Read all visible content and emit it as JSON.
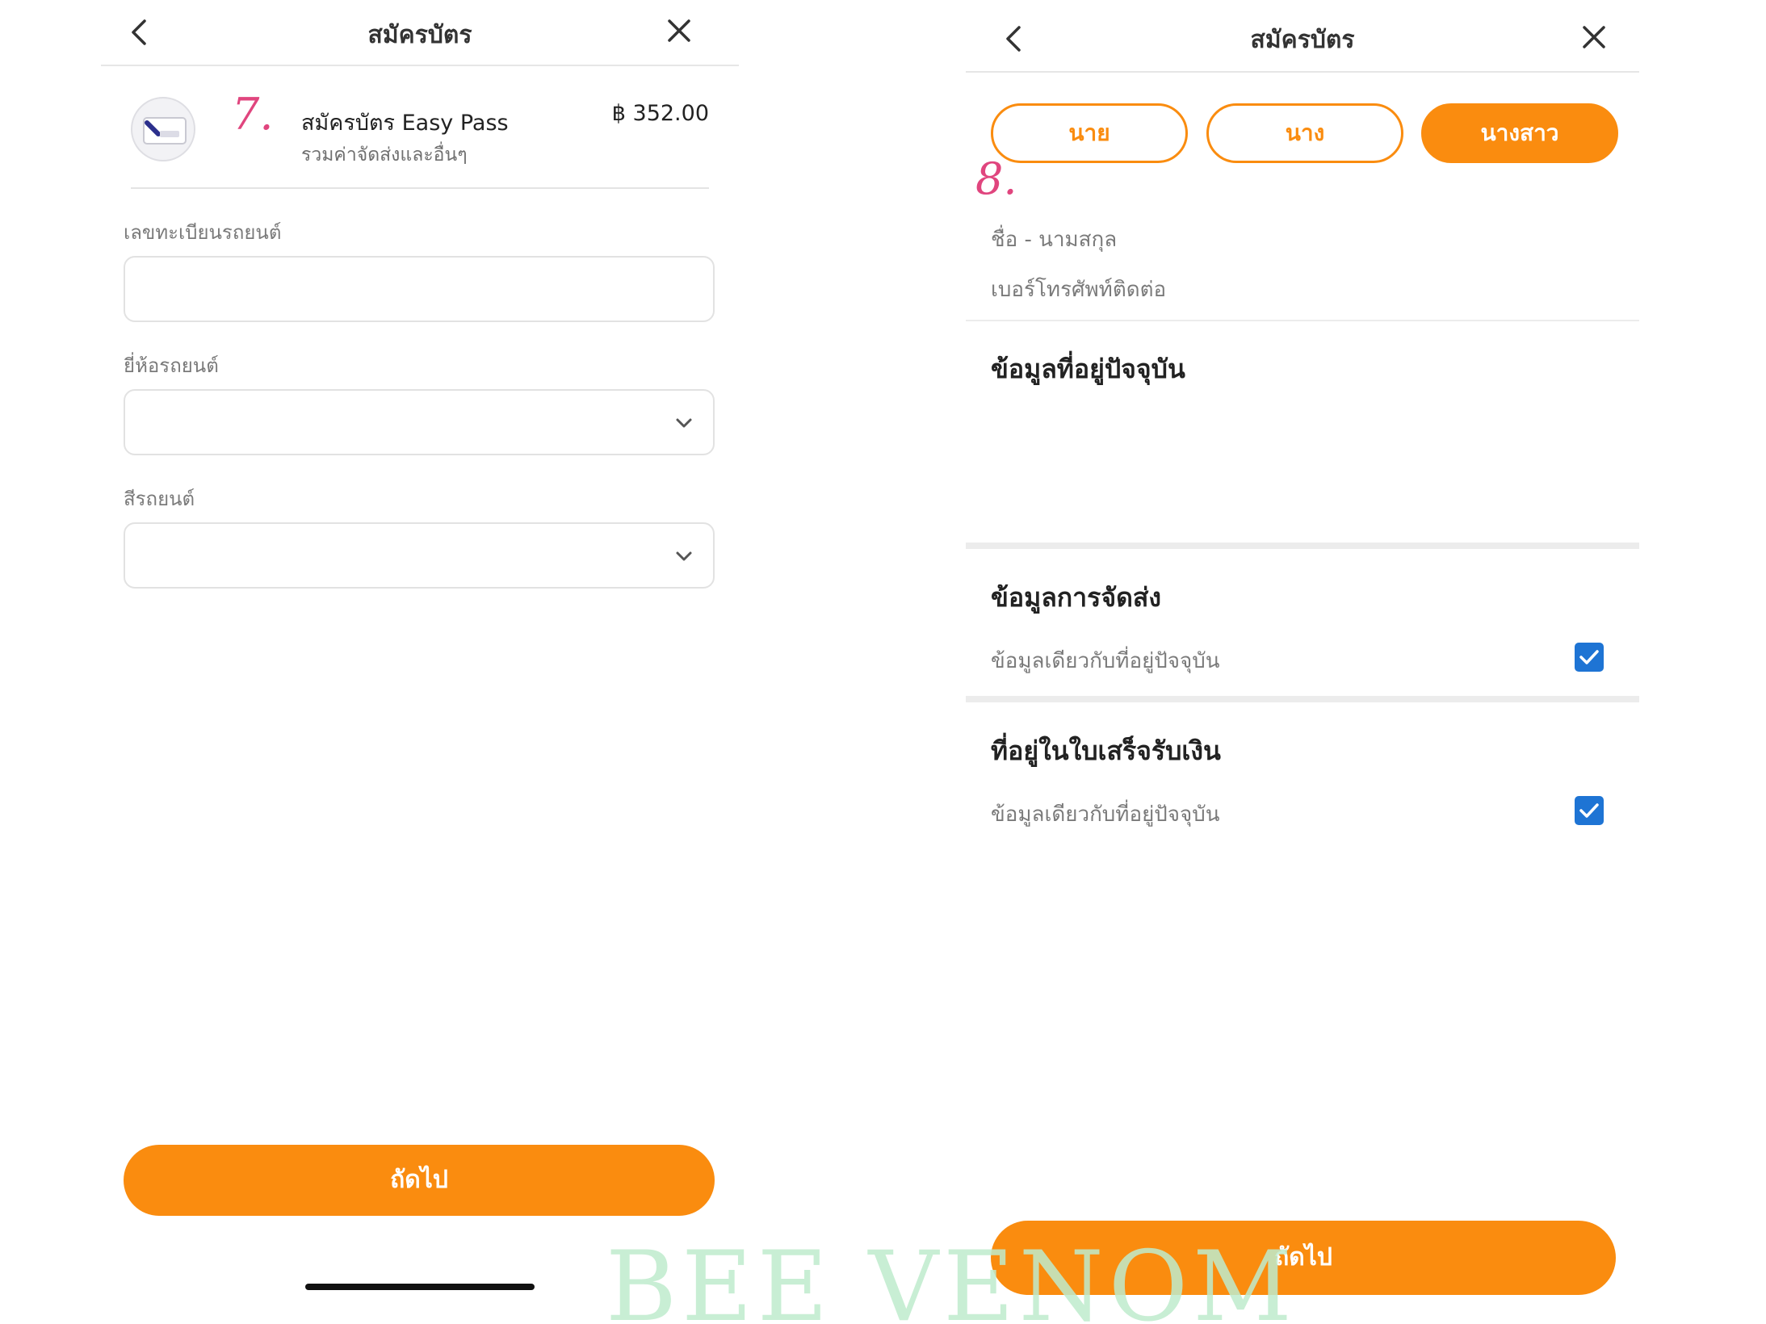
{
  "left_screen": {
    "nav": {
      "title": "สมัครบัตร",
      "back_icon": "chevron-left-icon",
      "close_icon": "close-icon"
    },
    "product": {
      "image_icon": "card-image",
      "name": "สมัครบัตร Easy Pass",
      "subtitle": "รวมค่าจัดส่งและอื่นๆ",
      "price": "฿ 352.00"
    },
    "annotation": "7.",
    "fields": {
      "plate_label": "เลขทะเบียนรถยนต์",
      "plate_value": "",
      "brand_label": "ยี่ห้อรถยนต์",
      "brand_value": "",
      "color_label": "สีรถยนต์",
      "color_value": ""
    },
    "next_button": "ถัดไป"
  },
  "right_screen": {
    "nav": {
      "title": "สมัครบัตร",
      "back_icon": "chevron-left-icon",
      "close_icon": "close-icon"
    },
    "titles": [
      {
        "label": "นาย",
        "selected": false
      },
      {
        "label": "นาง",
        "selected": false
      },
      {
        "label": "นางสาว",
        "selected": true
      }
    ],
    "annotation": "8.",
    "name_label": "ชื่อ - นามสกุล",
    "phone_label": "เบอร์โทรศัพท์ติดต่อ",
    "current_address_title": "ข้อมูลที่อยู่ปัจจุบัน",
    "shipping": {
      "title": "ข้อมูลการจัดส่ง",
      "same_label": "ข้อมูลเดียวกับที่อยู่ปัจจุบัน",
      "checked": true
    },
    "receipt": {
      "title": "ที่อยู่ในใบเสร็จรับเงิน",
      "same_label": "ข้อมูลเดียวกับที่อยู่ปัจจุบัน",
      "checked": true
    },
    "next_button": "ถัดไป"
  },
  "watermark": "BEE VENOM",
  "colors": {
    "accent": "#fa8c0f",
    "checkbox": "#1e74d4",
    "annotation": "#e0457e",
    "watermark": "#bfeccd"
  }
}
